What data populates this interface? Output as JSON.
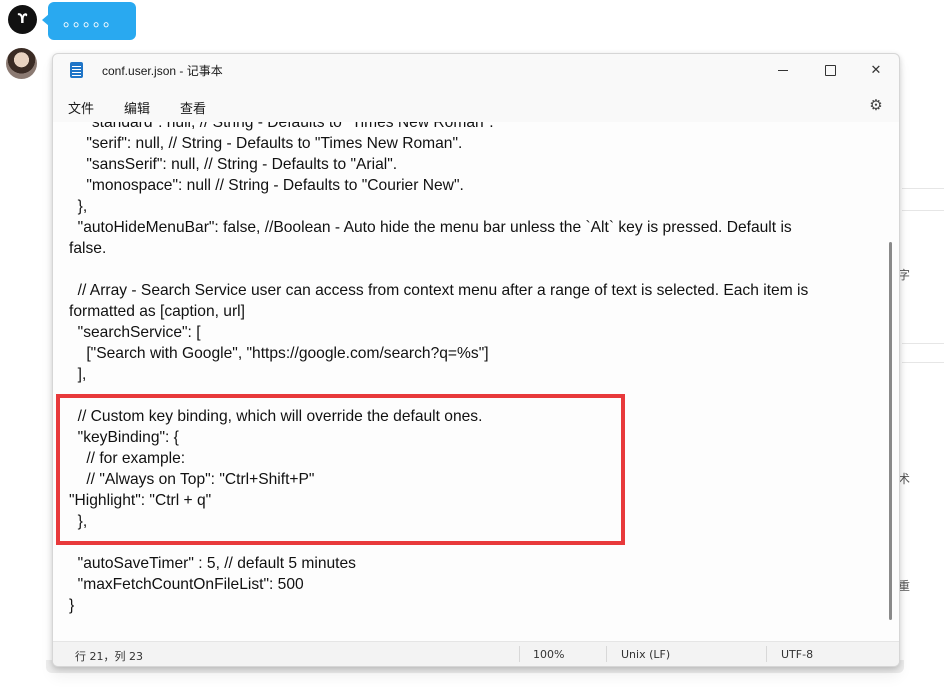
{
  "chat": {
    "sender_avatar_label": "ϒ",
    "bubble_text": "。。。。。"
  },
  "window": {
    "title": "conf.user.json - 记事本",
    "minimize_label": "",
    "close_label": "✕",
    "menu": {
      "file": "文件",
      "edit": "编辑",
      "view": "查看"
    },
    "settings_label": "⚙"
  },
  "editor": {
    "lines": [
      "    \"standard\": null, // String - Defaults to \"Times New Roman\".",
      "    \"serif\": null, // String - Defaults to \"Times New Roman\".",
      "    \"sansSerif\": null, // String - Defaults to \"Arial\".",
      "    \"monospace\": null // String - Defaults to \"Courier New\".",
      "  },",
      "  \"autoHideMenuBar\": false, //Boolean - Auto hide the menu bar unless the `Alt` key is pressed. Default is",
      "false.",
      "",
      "  // Array - Search Service user can access from context menu after a range of text is selected. Each item is",
      "formatted as [caption, url]",
      "  \"searchService\": [",
      "    [\"Search with Google\", \"https://google.com/search?q=%s\"]",
      "  ],",
      "",
      "  // Custom key binding, which will override the default ones.",
      "  \"keyBinding\": {",
      "    // for example:",
      "    // \"Always on Top\": \"Ctrl+Shift+P\"",
      "\"Highlight\": \"Ctrl + q\"",
      "  },",
      "",
      "  \"autoSaveTimer\" : 5, // default 5 minutes",
      "  \"maxFetchCountOnFileList\": 500",
      "}"
    ]
  },
  "status": {
    "position": "行 21，列 23",
    "zoom": "100%",
    "line_ending": "Unix (LF)",
    "encoding": "UTF-8"
  },
  "background_edge": {
    "glyph_1": "字",
    "glyph_2": "术",
    "glyph_3": "重"
  },
  "colors": {
    "bubble": "#29a9f0",
    "highlight_box": "#e8393b",
    "notepad_icon": "#1f75c7"
  }
}
